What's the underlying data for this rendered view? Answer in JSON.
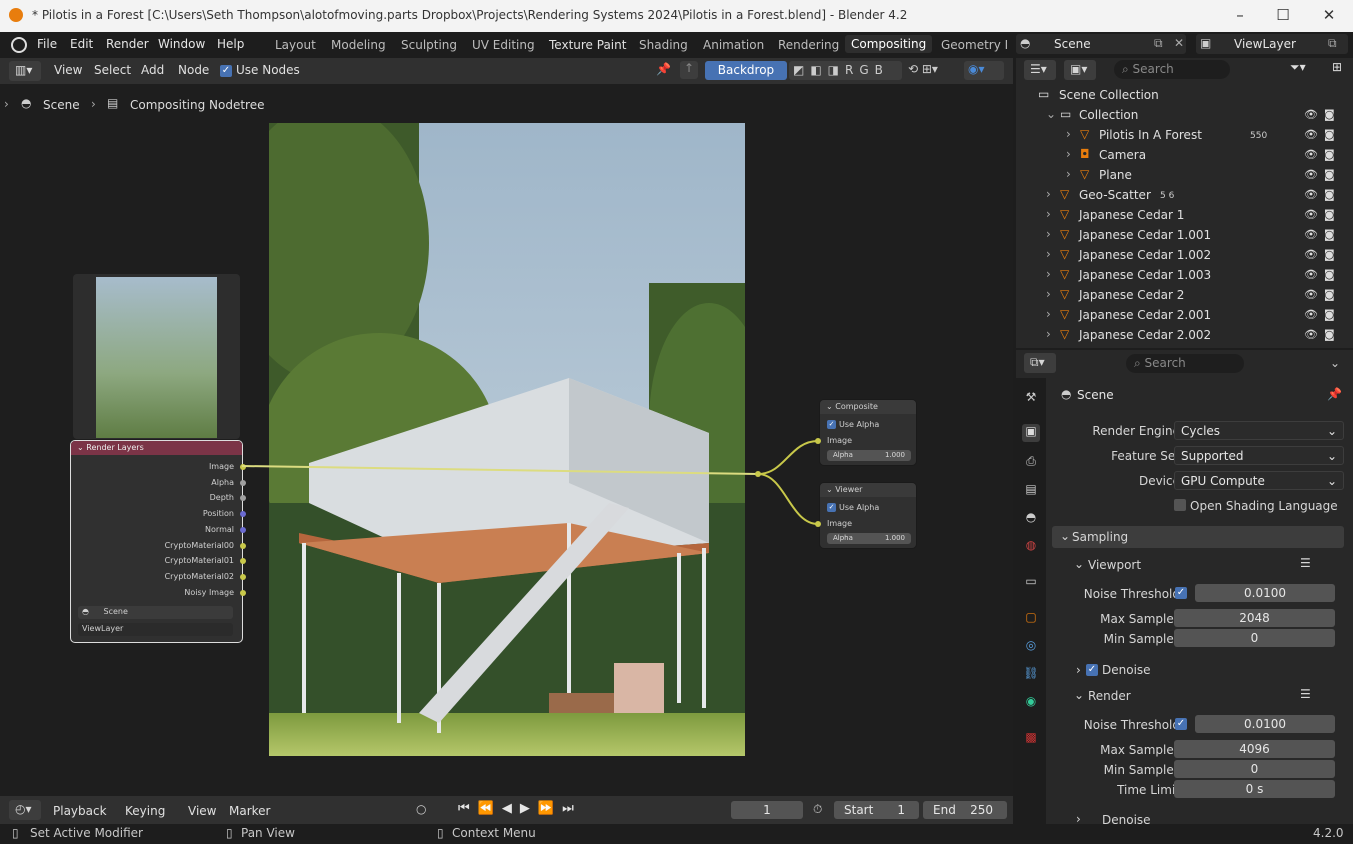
{
  "window": {
    "title": "* Pilotis in a Forest [C:\\Users\\Seth Thompson\\alotofmoving.parts Dropbox\\Projects\\Rendering Systems 2024\\Pilotis in a Forest.blend] - Blender 4.2"
  },
  "menu": [
    "File",
    "Edit",
    "Render",
    "Window",
    "Help"
  ],
  "workspaces": [
    "Layout",
    "Modeling",
    "Sculpting",
    "UV Editing",
    "Texture Paint",
    "Shading",
    "Animation",
    "Rendering",
    "Compositing",
    "Geometry No"
  ],
  "scene": {
    "name": "Scene",
    "view_layer": "ViewLayer"
  },
  "node_header": {
    "view": "View",
    "select": "Select",
    "add": "Add",
    "node": "Node",
    "use_nodes": "Use Nodes",
    "backdrop": "Backdrop"
  },
  "breadcrumb": {
    "scene": "Scene",
    "tree": "Compositing Nodetree"
  },
  "render_layers": {
    "title": "Render Layers",
    "outputs": [
      "Image",
      "Alpha",
      "Depth",
      "Position",
      "Normal",
      "CryptoMaterial00",
      "CryptoMaterial01",
      "CryptoMaterial02",
      "Noisy Image"
    ],
    "scene": "Scene",
    "layer": "ViewLayer"
  },
  "composite": {
    "title": "Composite",
    "use_alpha": "Use Alpha",
    "image": "Image",
    "alpha_label": "Alpha",
    "alpha": "1.000"
  },
  "viewer": {
    "title": "Viewer",
    "use_alpha": "Use Alpha",
    "image": "Image",
    "alpha_label": "Alpha",
    "alpha": "1.000"
  },
  "timeline": {
    "playback": "Playback",
    "keying": "Keying",
    "view": "View",
    "marker": "Marker",
    "frame": "1",
    "start_label": "Start",
    "start": "1",
    "end_label": "End",
    "end": "250"
  },
  "status": {
    "a": "Set Active Modifier",
    "b": "Pan View",
    "c": "Context Menu",
    "version": "4.2.0"
  },
  "outliner": {
    "search": "Search",
    "root": "Scene Collection",
    "rows": [
      {
        "name": "Collection",
        "indent": 1
      },
      {
        "name": "Pilotis In A Forest",
        "indent": 2,
        "badge": "550"
      },
      {
        "name": "Camera",
        "indent": 2
      },
      {
        "name": "Plane",
        "indent": 2
      },
      {
        "name": "Geo-Scatter",
        "indent": 1,
        "badge": "5 6"
      },
      {
        "name": "Japanese Cedar 1",
        "indent": 1
      },
      {
        "name": "Japanese Cedar 1.001",
        "indent": 1
      },
      {
        "name": "Japanese Cedar 1.002",
        "indent": 1
      },
      {
        "name": "Japanese Cedar 1.003",
        "indent": 1
      },
      {
        "name": "Japanese Cedar 2",
        "indent": 1
      },
      {
        "name": "Japanese Cedar 2.001",
        "indent": 1
      },
      {
        "name": "Japanese Cedar 2.002",
        "indent": 1
      }
    ]
  },
  "props": {
    "search": "Search",
    "title": "Scene",
    "render_engine_label": "Render Engine",
    "render_engine": "Cycles",
    "feature_set_label": "Feature Set",
    "feature_set": "Supported",
    "device_label": "Device",
    "device": "GPU Compute",
    "osl": "Open Shading Language",
    "sampling": "Sampling",
    "viewport": "Viewport",
    "noise_label": "Noise Threshold",
    "vp_noise": "0.0100",
    "max_label": "Max Samples",
    "vp_max": "2048",
    "min_label": "Min Samples",
    "vp_min": "0",
    "denoise": "Denoise",
    "render": "Render",
    "r_noise": "0.0100",
    "r_max": "4096",
    "r_min": "0",
    "time_label": "Time Limit",
    "time": "0 s"
  }
}
